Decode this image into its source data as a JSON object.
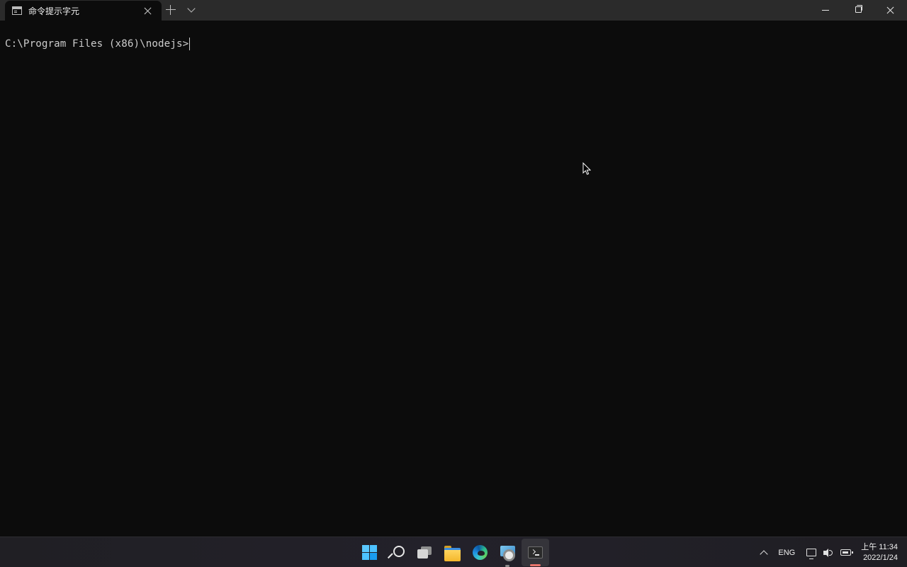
{
  "window": {
    "tab_title": "命令提示字元",
    "tab_icon": "cmd-icon",
    "controls": [
      "minimize",
      "restore",
      "close"
    ]
  },
  "console": {
    "prompt": "C:\\Program Files (x86)\\nodejs>"
  },
  "taskbar": {
    "apps": [
      {
        "name": "Start",
        "icon": "windows-start-icon"
      },
      {
        "name": "Search",
        "icon": "search-icon"
      },
      {
        "name": "Task View",
        "icon": "task-view-icon"
      },
      {
        "name": "File Explorer",
        "icon": "folder-icon"
      },
      {
        "name": "Microsoft Edge",
        "icon": "edge-icon"
      },
      {
        "name": "Settings",
        "icon": "settings-icon"
      },
      {
        "name": "Windows Terminal",
        "icon": "terminal-icon",
        "active": true
      }
    ],
    "tray": {
      "language": "ENG",
      "time": "上午 11:34",
      "date": "2022/1/24"
    }
  },
  "colors": {
    "console_bg": "#0c0c0c",
    "console_fg": "#cccccc",
    "titlebar_bg": "#2b2b2b",
    "active_indicator": "#e8736b",
    "start_blue": "#4cc2ff"
  }
}
